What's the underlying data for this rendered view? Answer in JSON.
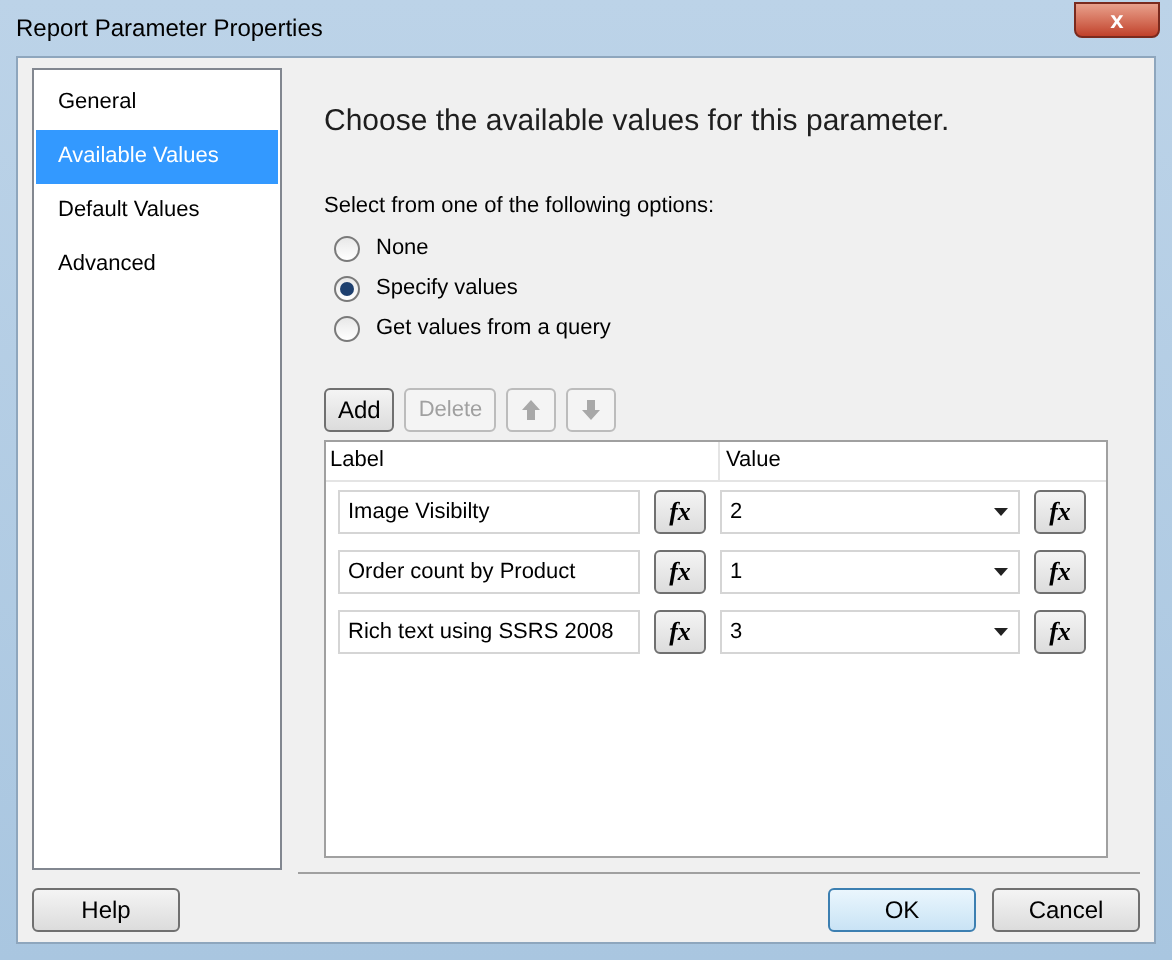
{
  "window": {
    "title": "Report Parameter Properties",
    "close": "x"
  },
  "sidebar": {
    "items": [
      {
        "label": "General",
        "selected": false
      },
      {
        "label": "Available Values",
        "selected": true
      },
      {
        "label": "Default Values",
        "selected": false
      },
      {
        "label": "Advanced",
        "selected": false
      }
    ]
  },
  "heading": "Choose the available values for this parameter.",
  "options_label": "Select from one of the following options:",
  "options": [
    {
      "label": "None",
      "selected": false
    },
    {
      "label": "Specify values",
      "selected": true
    },
    {
      "label": "Get values from a query",
      "selected": false
    }
  ],
  "toolbar": [
    {
      "kind": "text",
      "label": "Add",
      "disabled": false
    },
    {
      "kind": "text",
      "label": "Delete",
      "disabled": true
    },
    {
      "kind": "up",
      "disabled": true
    },
    {
      "kind": "down",
      "disabled": true
    }
  ],
  "table": {
    "columns": [
      "Label",
      "Value"
    ],
    "rows": [
      {
        "label": "Image Visibilty",
        "label_fx": "fx",
        "value": "2",
        "value_fx": "fx"
      },
      {
        "label": "Order count by Product",
        "label_fx": "fx",
        "value": "1",
        "value_fx": "fx"
      },
      {
        "label": "Rich text using SSRS 2008",
        "label_fx": "fx",
        "value": "3",
        "value_fx": "fx"
      }
    ]
  },
  "buttons": {
    "help": "Help",
    "ok": "OK",
    "cancel": "Cancel"
  }
}
